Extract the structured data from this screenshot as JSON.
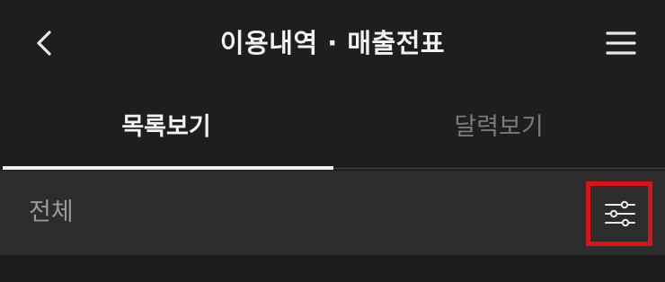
{
  "header": {
    "title": "이용내역 · 매출전표",
    "back_icon": "chevron-left-icon",
    "menu_icon": "hamburger-menu-icon"
  },
  "tabs": [
    {
      "label": "목록보기",
      "active": true
    },
    {
      "label": "달력보기",
      "active": false
    }
  ],
  "filter": {
    "label": "전체",
    "icon": "filter-sliders-icon",
    "highlight_color": "#d8141b"
  },
  "colors": {
    "background": "#1e1e1e",
    "filter_row": "#2c2c2c",
    "active_text": "#f2f2f2",
    "inactive_text": "#7a7a7a"
  }
}
